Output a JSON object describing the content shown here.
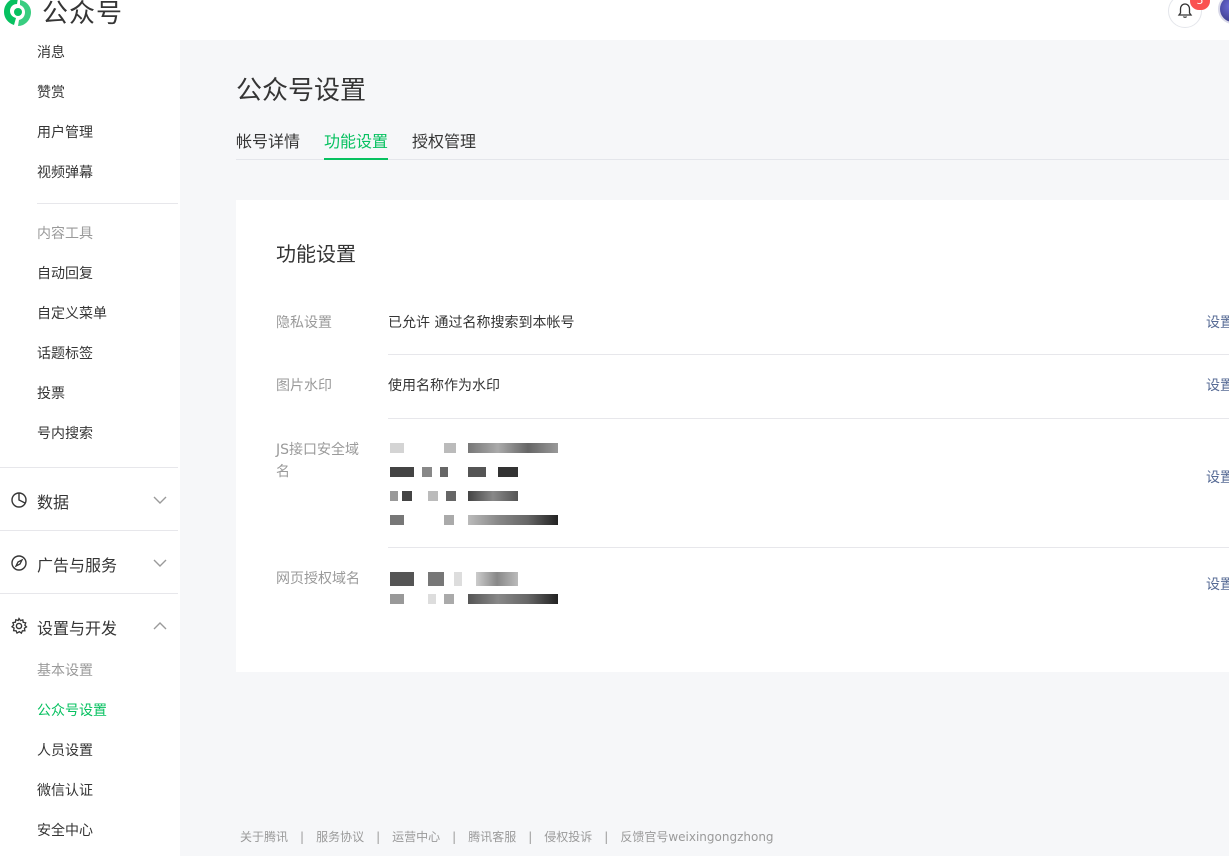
{
  "header": {
    "app_name": "公众号",
    "notification_count": "5"
  },
  "sidebar": {
    "items_top": [
      "消息",
      "赞赏",
      "用户管理",
      "视频弹幕"
    ],
    "content_tools_label": "内容工具",
    "content_tools": [
      "自动回复",
      "自定义菜单",
      "话题标签",
      "投票",
      "号内搜索"
    ],
    "groups": {
      "data": "数据",
      "ads": "广告与服务",
      "settings": "设置与开发"
    },
    "settings_items": {
      "basic": "基本设置",
      "account": "公众号设置",
      "staff": "人员设置",
      "verify": "微信认证",
      "security": "安全中心"
    }
  },
  "main": {
    "title": "公众号设置",
    "tabs": [
      "帐号详情",
      "功能设置",
      "授权管理"
    ],
    "active_tab": "功能设置",
    "card": {
      "title": "功能设置",
      "rows": {
        "privacy": {
          "label": "隐私设置",
          "value": "已允许 通过名称搜索到本帐号",
          "action": "设置"
        },
        "watermark": {
          "label": "图片水印",
          "value": "使用名称作为水印",
          "action": "设置"
        },
        "js_domain": {
          "label_line1": "JS接口安全域",
          "label_line2": "名",
          "action": "设置"
        },
        "web_auth": {
          "label": "网页授权域名",
          "action": "设置"
        }
      }
    }
  },
  "footer": {
    "links": [
      "关于腾讯",
      "服务协议",
      "运营中心",
      "腾讯客服",
      "侵权投诉",
      "反馈官号weixingongzhong"
    ],
    "separator": "|"
  },
  "colors": {
    "accent": "#07c160",
    "link": "#576b95",
    "badge": "#fa5151"
  }
}
